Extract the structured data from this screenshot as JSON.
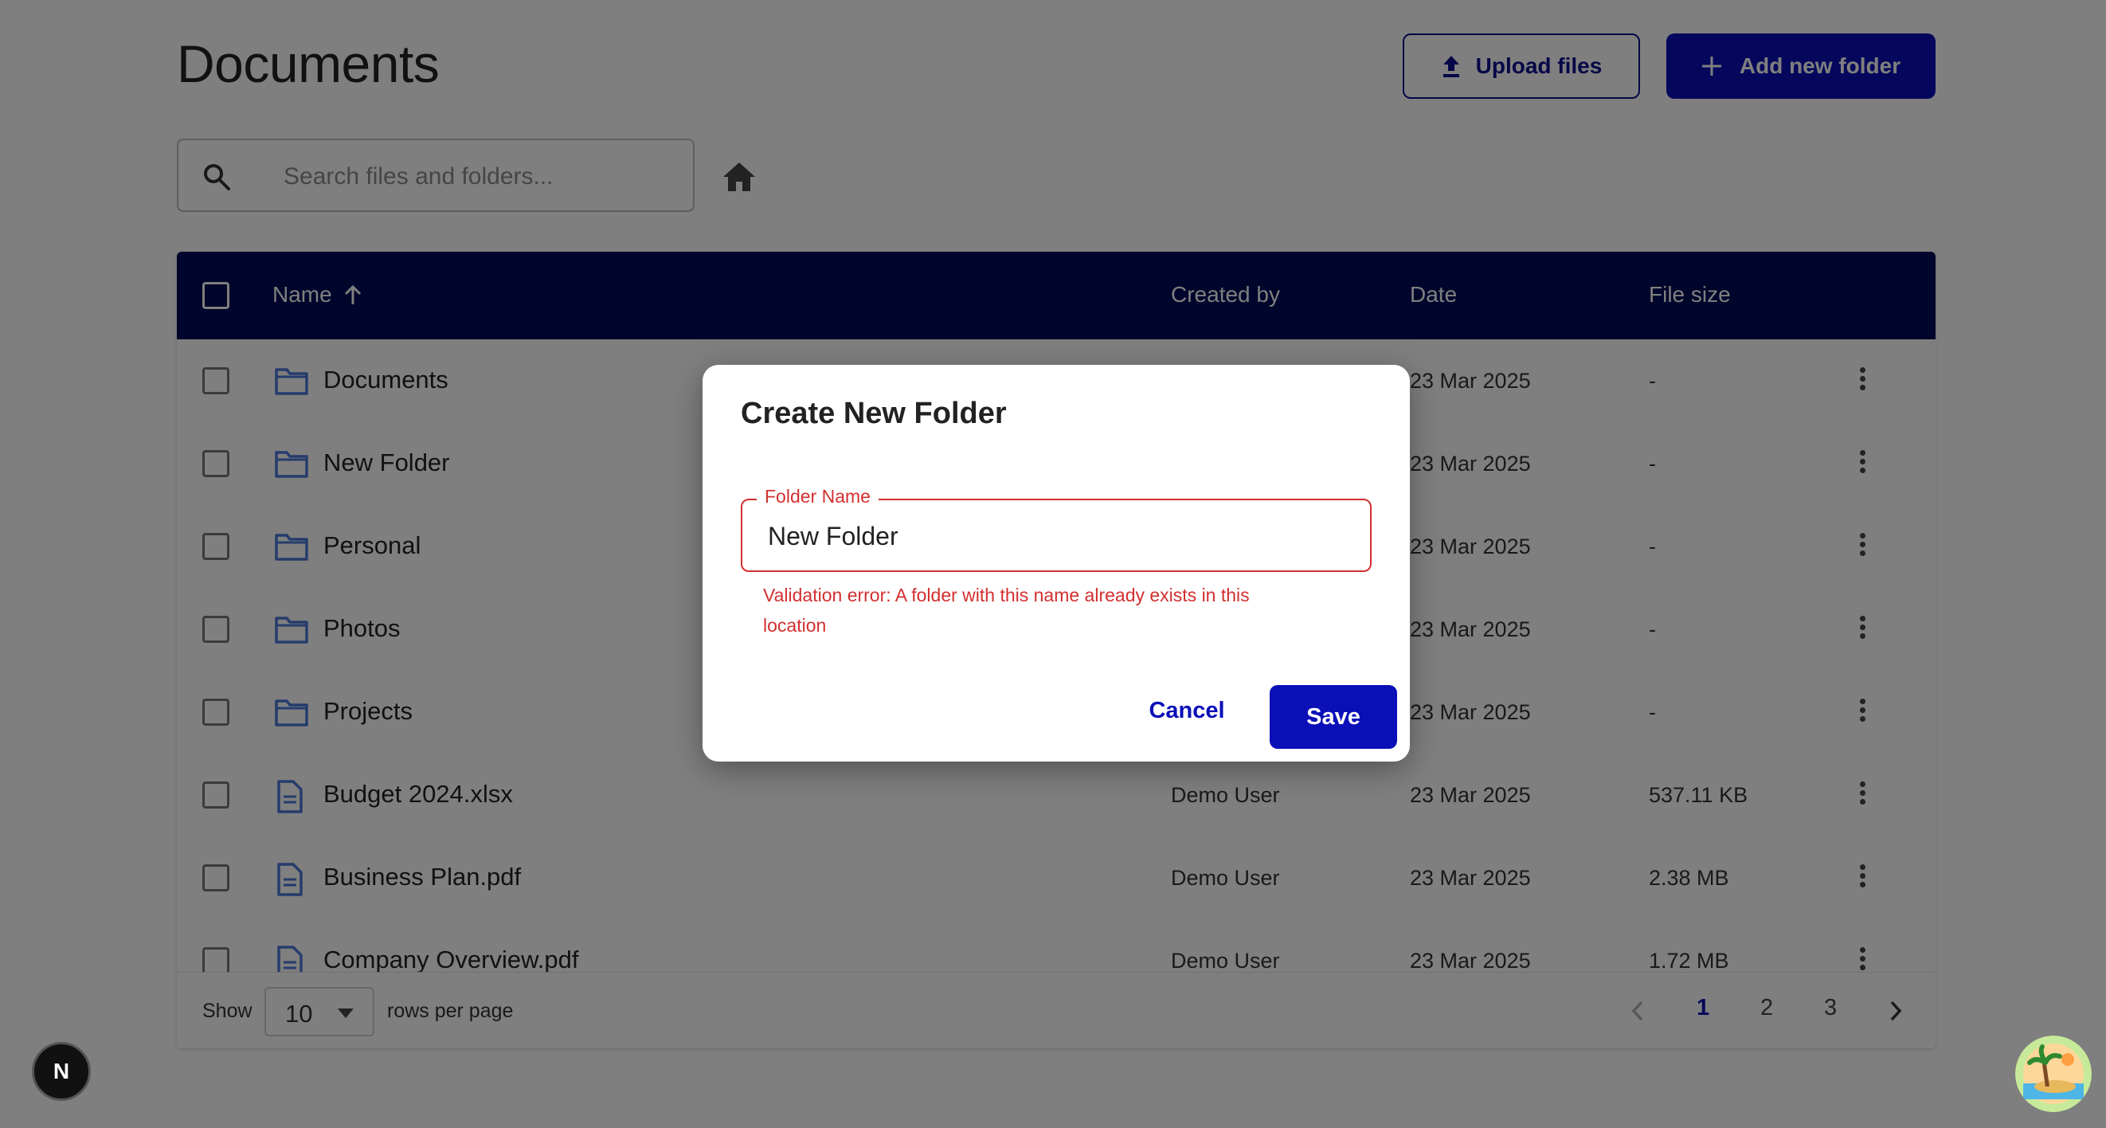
{
  "page": {
    "title": "Documents",
    "upload_label": "Upload files",
    "add_label": "Add new folder"
  },
  "search": {
    "placeholder": "Search files and folders..."
  },
  "table": {
    "columns": {
      "name": "Name",
      "created_by": "Created by",
      "date": "Date",
      "size": "File size"
    },
    "sort": {
      "column": "Name",
      "direction": "ascending",
      "icon": "arrow-up-icon"
    },
    "rows": [
      {
        "type": "folder",
        "icon": "folder-icon",
        "name": "Documents",
        "created_by": "",
        "date": "23 Mar 2025",
        "size": "-"
      },
      {
        "type": "folder",
        "icon": "folder-icon",
        "name": "New Folder",
        "created_by": "",
        "date": "23 Mar 2025",
        "size": "-"
      },
      {
        "type": "folder",
        "icon": "folder-icon",
        "name": "Personal",
        "created_by": "",
        "date": "23 Mar 2025",
        "size": "-"
      },
      {
        "type": "folder",
        "icon": "folder-icon",
        "name": "Photos",
        "created_by": "",
        "date": "23 Mar 2025",
        "size": "-"
      },
      {
        "type": "folder",
        "icon": "folder-icon",
        "name": "Projects",
        "created_by": "",
        "date": "23 Mar 2025",
        "size": "-"
      },
      {
        "type": "file",
        "icon": "file-icon",
        "name": "Budget 2024.xlsx",
        "created_by": "Demo User",
        "date": "23 Mar 2025",
        "size": "537.11 KB"
      },
      {
        "type": "file",
        "icon": "file-icon",
        "name": "Business Plan.pdf",
        "created_by": "Demo User",
        "date": "23 Mar 2025",
        "size": "2.38 MB"
      },
      {
        "type": "file",
        "icon": "file-icon",
        "name": "Company Overview.pdf",
        "created_by": "Demo User",
        "date": "23 Mar 2025",
        "size": "1.72 MB"
      }
    ]
  },
  "footer": {
    "show_label": "Show",
    "rows_per_page": "10",
    "rows_per_page_label": "rows per page",
    "pages": [
      "1",
      "2",
      "3"
    ],
    "current_page": "1"
  },
  "dialog": {
    "title": "Create New Folder",
    "field_label": "Folder Name",
    "field_value": "New Folder",
    "error": "Validation error: A folder with this name already exists in this location",
    "cancel_label": "Cancel",
    "save_label": "Save"
  },
  "badge": {
    "letter": "N"
  },
  "colors": {
    "primary": "#0a0fb8",
    "header_bg": "#000b57",
    "error": "#d32f2f",
    "folder_icon": "#4a78d8"
  }
}
